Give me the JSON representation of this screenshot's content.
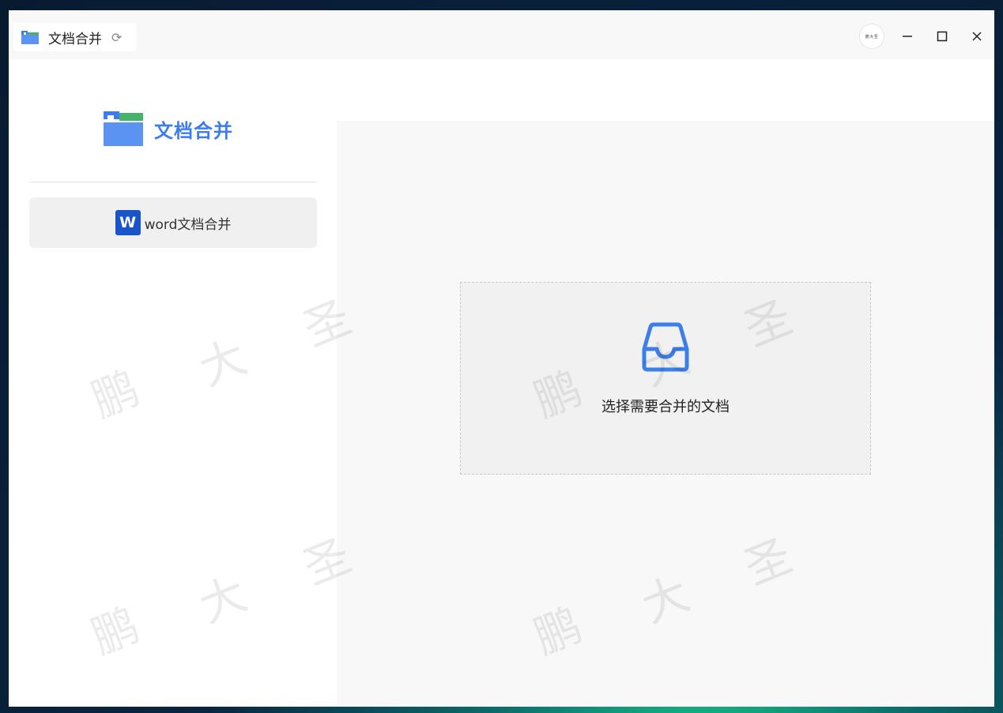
{
  "app": {
    "title": "文档合并",
    "logo_text": "文档合并",
    "avatar_text": "鹏大圣"
  },
  "sidebar": {
    "items": [
      {
        "icon": "word-icon",
        "icon_letter": "W",
        "label": "word文档合并"
      }
    ]
  },
  "main": {
    "dropzone_hint": "选择需要合并的文档"
  },
  "watermark": {
    "chars": [
      "鹏",
      "大",
      "圣"
    ]
  },
  "colors": {
    "accent": "#3b7cf0",
    "word_blue": "#1955c9",
    "logo_green": "#43b46a"
  }
}
